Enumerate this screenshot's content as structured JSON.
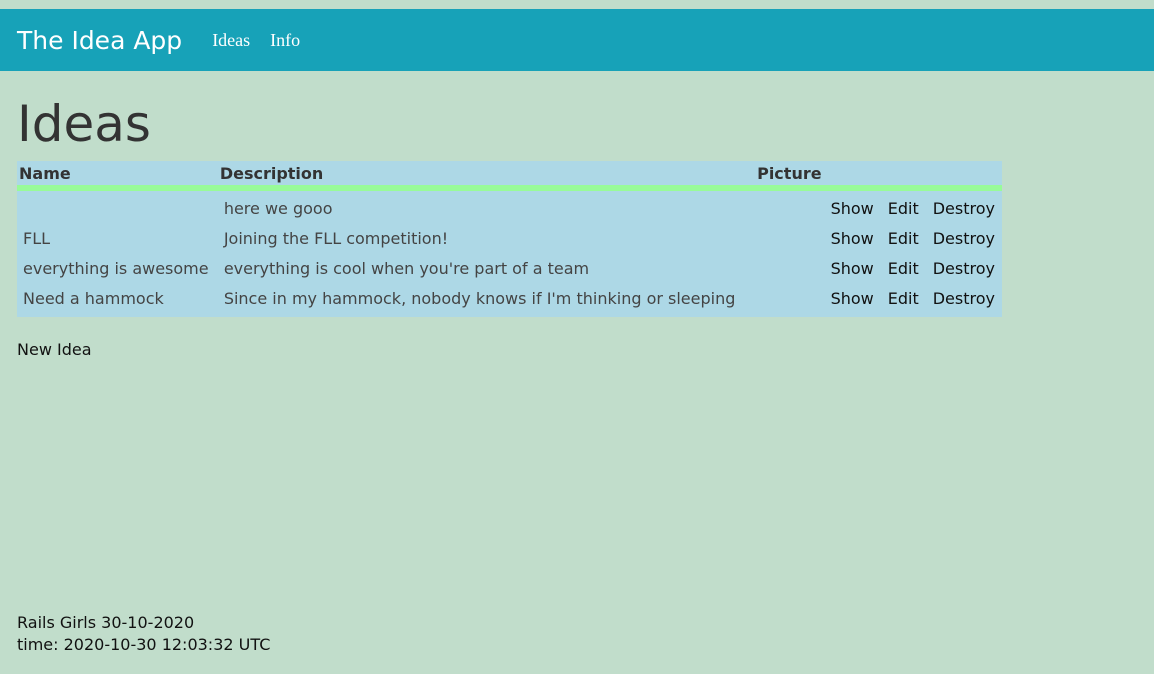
{
  "navbar": {
    "brand": "The Idea App",
    "links": [
      "Ideas",
      "Info"
    ]
  },
  "page": {
    "title": "Ideas"
  },
  "table": {
    "headers": [
      "Name",
      "Description",
      "Picture"
    ],
    "actions": [
      "Show",
      "Edit",
      "Destroy"
    ],
    "rows": [
      {
        "name": "",
        "description": "here we gooo"
      },
      {
        "name": "FLL",
        "description": "Joining the FLL competition!"
      },
      {
        "name": "everything is awesome",
        "description": "everything is cool when you're part of a team"
      },
      {
        "name": "Need a hammock",
        "description": "Since in my hammock, nobody knows if I'm thinking or sleeping"
      }
    ]
  },
  "new_idea_label": "New Idea",
  "footer": {
    "line1": "Rails Girls 30-10-2020",
    "line2": "time: 2020-10-30 12:03:32 UTC"
  },
  "colors": {
    "navbar": "#17a2b8",
    "background": "#c1ddcb",
    "table": "#add8e6",
    "header_border": "#98fb98"
  }
}
